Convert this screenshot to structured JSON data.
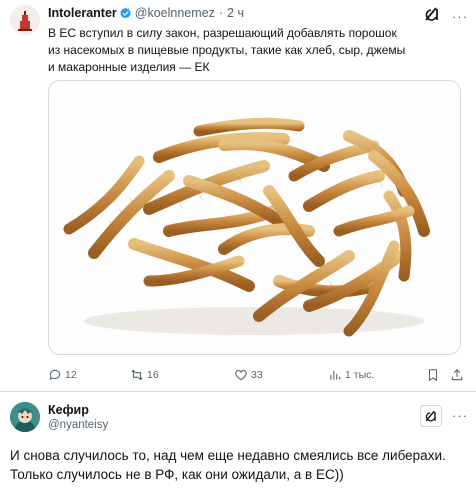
{
  "quoted_post": {
    "author_name": "Intoleranter",
    "handle": "@koelnnemez",
    "separator": "·",
    "time": "2 ч",
    "text": "В ЕС вступил в силу закон, разрешающий добавлять порошок из насекомых в пищевые продукты, такие как хлеб, сыр, джемы и макаронные изделия — ЕК",
    "media_icon": "mealworms-photo",
    "actions": {
      "replies": "12",
      "reposts": "16",
      "likes": "33",
      "views": "1 тыс."
    }
  },
  "reply_post": {
    "author_name": "Кефир",
    "handle": "@nyanteisy",
    "text_line1": "И снова случилось то, над чем еще недавно смеялись все либерахи.",
    "text_line2": "Только случилось не в РФ, как они ожидали, а в ЕС))"
  },
  "colors": {
    "text": "#0f1419",
    "secondary": "#536471",
    "verified": "#1d9bf0",
    "border": "#cfd9de"
  }
}
